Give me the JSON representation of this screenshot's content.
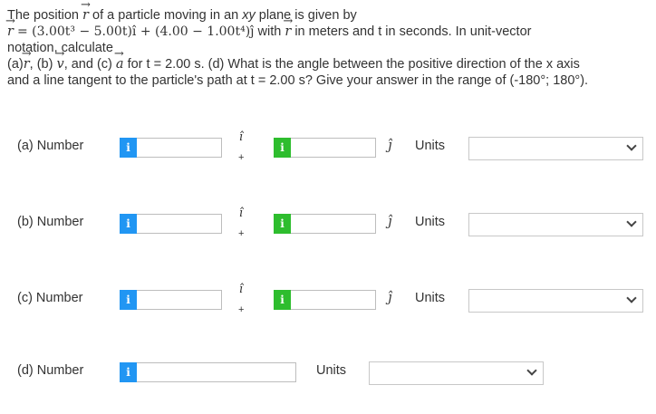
{
  "problem": {
    "line1_a": "The position",
    "line1_b": "of a particle moving in an",
    "xy": "xy",
    "line1_c": "plane is given by",
    "equation": "= (3.00t³ − 5.00t)î + (4.00 − 1.00t⁴)ĵ",
    "with_text": "with",
    "line2_tail": "in meters and t in seconds. In unit-vector",
    "line3": "notation, calculate",
    "line4_a": "(a)",
    "line4_b": ", (b)",
    "line4_c": ", and (c)",
    "line4_d": "for t = 2.00 s. (d) What is the angle between the positive direction of the x axis",
    "line5": "and a line tangent to the particle's path at t = 2.00 s? Give your answer in the range of (-180°; 180°).",
    "vec_r": "r",
    "vec_v": "v",
    "vec_a": "a"
  },
  "rows": [
    {
      "label": "(a)  Number",
      "i_hat": "î",
      "plus": "+",
      "j_hat": "ĵ",
      "units": "Units"
    },
    {
      "label": "(b)  Number",
      "i_hat": "î",
      "plus": "+",
      "j_hat": "ĵ",
      "units": "Units"
    },
    {
      "label": "(c)  Number",
      "i_hat": "î",
      "plus": "+",
      "j_hat": "ĵ",
      "units": "Units"
    },
    {
      "label": "(d)  Number",
      "units": "Units"
    }
  ],
  "info_glyph": "i",
  "icons": {
    "info": "info-icon",
    "dropdown": "chevron-down-icon"
  },
  "colors": {
    "info_blue": "#2196f3",
    "info_green": "#2ebd2e"
  }
}
